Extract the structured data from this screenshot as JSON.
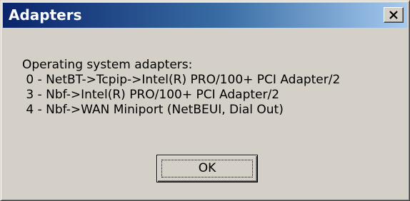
{
  "window": {
    "title": "Adapters",
    "close_icon": "close-icon"
  },
  "message": {
    "lines": [
      "Operating system adapters:",
      " 0 - NetBT->Tcpip->Intel(R) PRO/100+ PCI Adapter/2",
      " 3 - Nbf->Intel(R) PRO/100+ PCI Adapter/2",
      " 4 - Nbf->WAN Miniport (NetBEUI, Dial Out)"
    ]
  },
  "buttons": {
    "ok_label": "OK"
  },
  "colors": {
    "titlebar_start": "#0a246a",
    "titlebar_end": "#a6caf0",
    "face": "#d4d0c8"
  }
}
